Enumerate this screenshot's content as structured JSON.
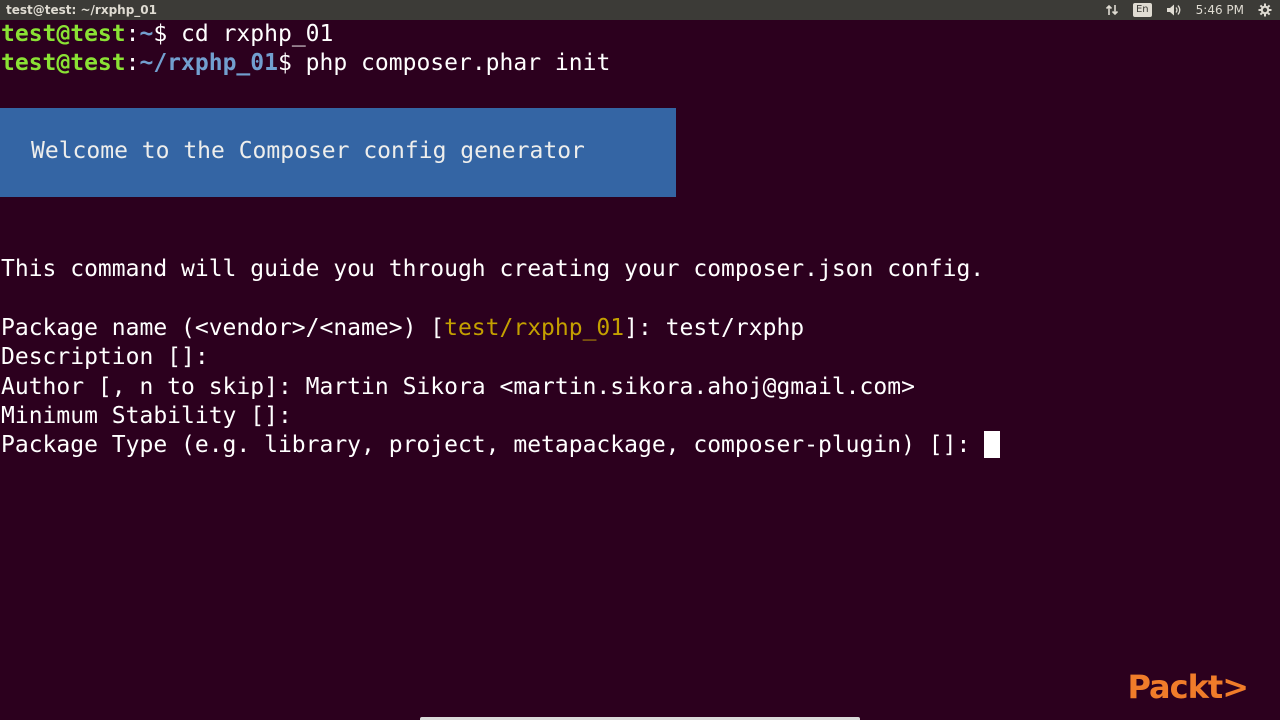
{
  "window": {
    "title": "test@test: ~/rxphp_01"
  },
  "tray": {
    "keyboard_layout": "En",
    "time": "5:46 PM"
  },
  "terminal": {
    "line1": {
      "user": "test@test",
      "sep": ":",
      "path": "~",
      "prompt": "$ ",
      "command": "cd rxphp_01"
    },
    "line2": {
      "user": "test@test",
      "sep": ":",
      "path": "~/rxphp_01",
      "prompt": "$ ",
      "command": "php composer.phar init"
    },
    "banner": "Welcome to the Composer config generator",
    "intro": "This command will guide you through creating your composer.json config.",
    "package_name": {
      "label": "Package name (<vendor>/<name>) [",
      "default": "test/rxphp_01",
      "suffix": "]: ",
      "value": "test/rxphp"
    },
    "description": "Description []:",
    "author": "Author [, n to skip]: Martin Sikora <martin.sikora.ahoj@gmail.com>",
    "minimum_stability": "Minimum Stability []:",
    "package_type": "Package Type (e.g. library, project, metapackage, composer-plugin) []: "
  },
  "watermark": {
    "logo": "Packt>"
  },
  "colors": {
    "background": "#2c001e",
    "banner": "#3465a4",
    "user": "#8ae234",
    "path": "#729fcf",
    "default_value": "#c4a000",
    "logo": "#f07c2a"
  },
  "icons": [
    "network-icon",
    "keyboard-icon",
    "volume-icon",
    "gear-icon"
  ]
}
